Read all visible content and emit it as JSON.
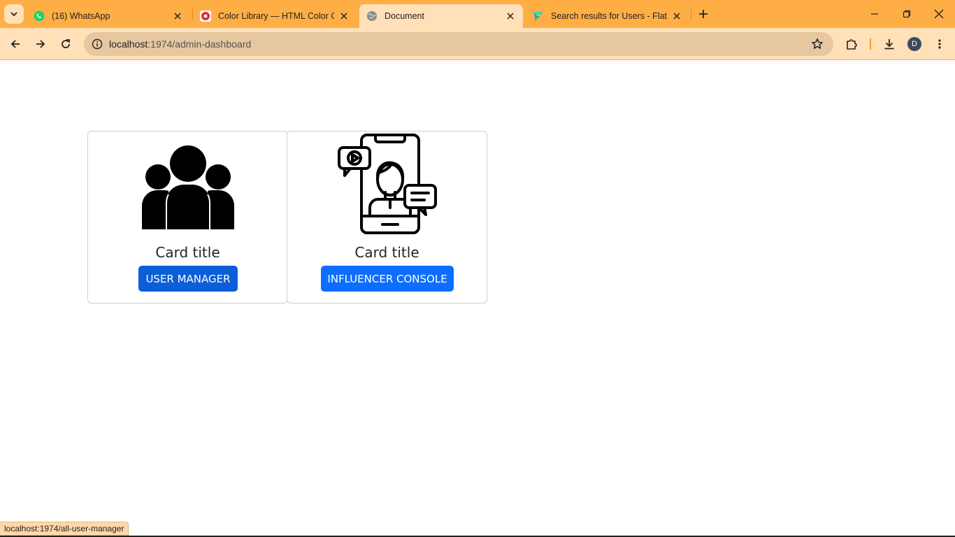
{
  "browser": {
    "tabs": [
      {
        "title": "(16) WhatsApp",
        "icon": "whatsapp-icon",
        "active": false
      },
      {
        "title": "Color Library — HTML Color Co",
        "icon": "color-library-icon",
        "active": false
      },
      {
        "title": "Document",
        "icon": "globe-icon",
        "active": true
      },
      {
        "title": "Search results for Users - Flatic",
        "icon": "flaticon-icon",
        "active": false
      }
    ],
    "address": {
      "host": "localhost",
      "path": ":1974/admin-dashboard"
    },
    "profile_initial": "D",
    "accent": "#ffae45",
    "toolbar_color": "#ffe0b8"
  },
  "cards": [
    {
      "title": "Card title",
      "button_label": "USER MANAGER",
      "button_color": "#0b5ed7",
      "image": "users-group-icon"
    },
    {
      "title": "Card title",
      "button_label": "INFLUENCER CONSOLE",
      "button_color": "#0d6efd",
      "image": "influencer-phone-icon"
    }
  ],
  "status_url": "localhost:1974/all-user-manager"
}
